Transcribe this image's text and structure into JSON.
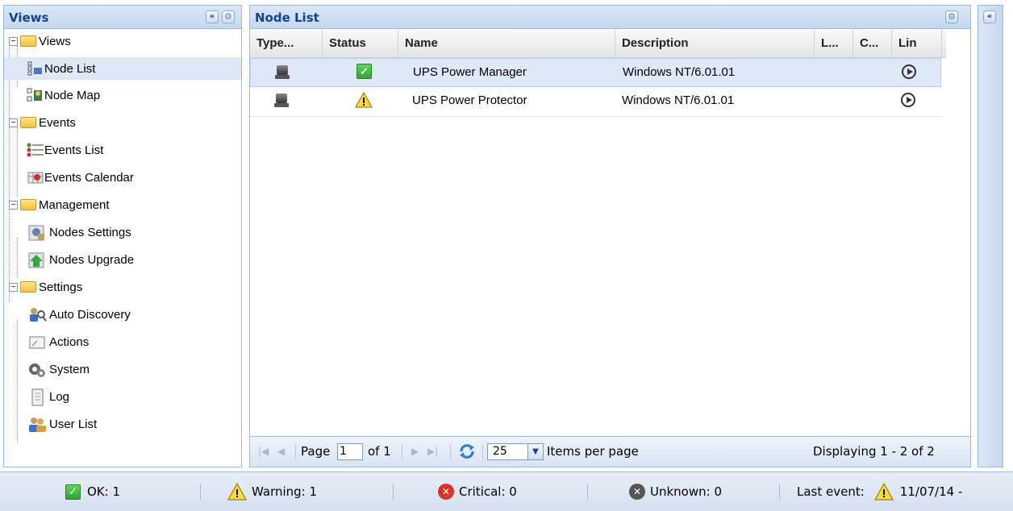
{
  "west": {
    "title": "Views",
    "tree": [
      {
        "label": "Views",
        "type": "folder"
      },
      {
        "label": "Node List",
        "icon": "node-list-icon",
        "selected": true
      },
      {
        "label": "Node Map",
        "icon": "node-map-icon"
      },
      {
        "label": "Events",
        "type": "folder"
      },
      {
        "label": "Events List",
        "icon": "events-list-icon"
      },
      {
        "label": "Events Calendar",
        "icon": "events-calendar-icon"
      },
      {
        "label": "Management",
        "type": "folder"
      },
      {
        "label": "Nodes Settings",
        "icon": "nodes-settings-icon"
      },
      {
        "label": "Nodes Upgrade",
        "icon": "nodes-upgrade-icon"
      },
      {
        "label": "Settings",
        "type": "folder"
      },
      {
        "label": "Auto Discovery",
        "icon": "auto-discovery-icon"
      },
      {
        "label": "Actions",
        "icon": "actions-icon"
      },
      {
        "label": "System",
        "icon": "system-gear-icon"
      },
      {
        "label": "Log",
        "icon": "log-icon"
      },
      {
        "label": "User List",
        "icon": "user-list-icon"
      }
    ]
  },
  "center": {
    "title": "Node List",
    "columns": [
      "Type...",
      "Status",
      "Name",
      "Description",
      "L...",
      "C...",
      "Lin"
    ],
    "rows": [
      {
        "name": "UPS Power Manager",
        "description": "Windows NT/6.01.01",
        "status": "ok"
      },
      {
        "name": "UPS Power Protector",
        "description": "Windows NT/6.01.01",
        "status": "warning"
      }
    ],
    "pager": {
      "page_label": "Page",
      "page_value": "1",
      "of_label": "of 1",
      "page_size": "25",
      "items_per_page": "Items per page",
      "displaying": "Displaying 1 - 2 of 2"
    }
  },
  "statusbar": {
    "ok": "OK: 1",
    "warning": "Warning: 1",
    "critical": "Critical: 0",
    "unknown": "Unknown: 0",
    "last_event_label": "Last event:",
    "last_event_value": "11/07/14 -"
  },
  "colors": {
    "header_blue": "#15428b",
    "border_blue": "#99bbe8",
    "selection": "#dfe8f6",
    "ok_green": "#2ea82e",
    "critical_red": "#d9342b",
    "unknown_gray": "#555555"
  }
}
